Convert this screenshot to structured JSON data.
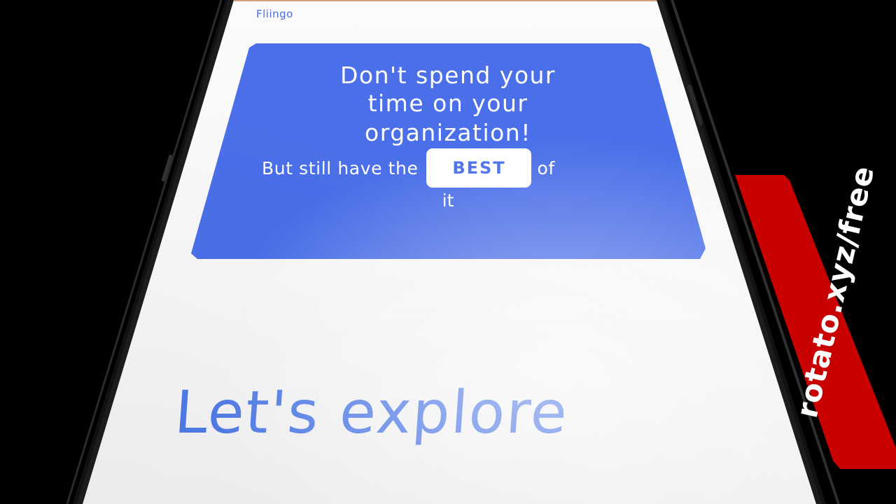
{
  "app": {
    "brand": "Fliingo"
  },
  "hero": {
    "line1": "Don't spend your",
    "line2": "time on your",
    "line3": "organization!",
    "sub_before": "But still have the",
    "badge": "BEST",
    "sub_after": "of",
    "sub_end": "it"
  },
  "main": {
    "heading_line1": "Let's explore",
    "heading_line2": ""
  },
  "watermark": {
    "text": "rotato.xyz/free"
  },
  "colors": {
    "accent": "#4a6fe8",
    "heading": "#4f7ae8",
    "watermark": "#c80000",
    "background": "#000000"
  }
}
